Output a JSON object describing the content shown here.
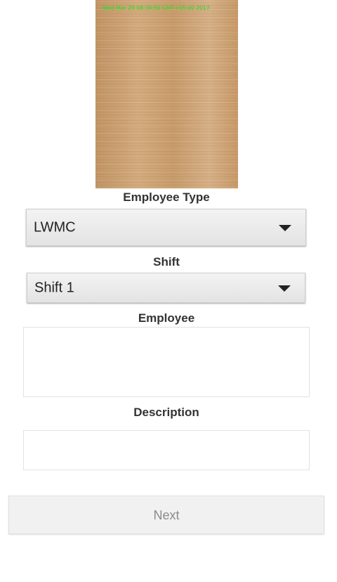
{
  "photo": {
    "timestamp": "Wed Mar 29 08:39:50 GMT+05:00 2017",
    "timestamp_color": "#22e022"
  },
  "employee_type": {
    "label": "Employee Type",
    "selected": "LWMC"
  },
  "shift": {
    "label": "Shift",
    "selected": "Shift 1"
  },
  "employee": {
    "label": "Employee",
    "value": ""
  },
  "description": {
    "label": "Description",
    "value": ""
  },
  "next_button": {
    "label": "Next"
  },
  "icons": {
    "dropdown": "triangle-down-icon"
  }
}
